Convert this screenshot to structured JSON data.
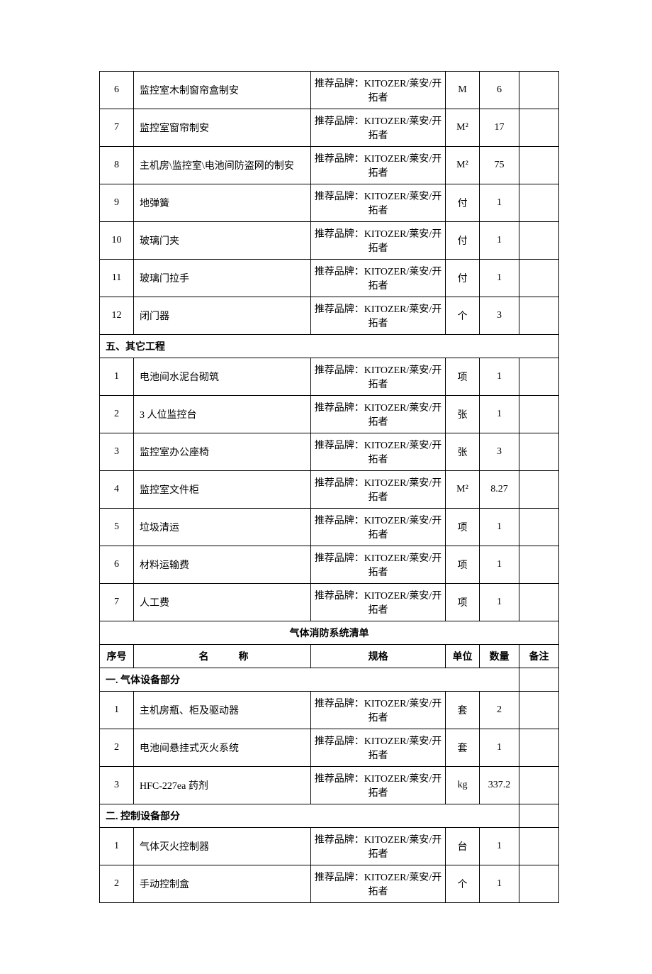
{
  "brand_spec": "推荐品牌：KITOZER/莱安/开拓者",
  "rows_top": [
    {
      "seq": "6",
      "name": "监控室木制窗帘盒制安",
      "unit": "M",
      "qty": "6"
    },
    {
      "seq": "7",
      "name": "监控室窗帘制安",
      "unit": "M²",
      "qty": "17"
    },
    {
      "seq": "8",
      "name": "主机房\\监控室\\电池间防盗网的制安",
      "unit": "M²",
      "qty": "75"
    },
    {
      "seq": "9",
      "name": "地弹簧",
      "unit": "付",
      "qty": "1"
    },
    {
      "seq": "10",
      "name": "玻璃门夹",
      "unit": "付",
      "qty": "1"
    },
    {
      "seq": "11",
      "name": "玻璃门拉手",
      "unit": "付",
      "qty": "1"
    },
    {
      "seq": "12",
      "name": "闭门器",
      "unit": "个",
      "qty": "3"
    }
  ],
  "section5_title": "五、其它工程",
  "rows_section5": [
    {
      "seq": "1",
      "name": "电池间水泥台砌筑",
      "unit": "项",
      "qty": "1"
    },
    {
      "seq": "2",
      "name": "3 人位监控台",
      "unit": "张",
      "qty": "1"
    },
    {
      "seq": "3",
      "name": "监控室办公座椅",
      "unit": "张",
      "qty": "3"
    },
    {
      "seq": "4",
      "name": "监控室文件柜",
      "unit": "M²",
      "qty": "8.27"
    },
    {
      "seq": "5",
      "name": "垃圾清运",
      "unit": "项",
      "qty": "1"
    },
    {
      "seq": "6",
      "name": "材料运输费",
      "unit": "项",
      "qty": "1"
    },
    {
      "seq": "7",
      "name": "人工费",
      "unit": "项",
      "qty": "1"
    }
  ],
  "gas_list_title": "气体消防系统清单",
  "headers": {
    "seq": "序号",
    "name": "名",
    "name2": "称",
    "spec": "规格",
    "unit": "单位",
    "qty": "数量",
    "note": "备注"
  },
  "gas_section1_title": "一. 气体设备部分",
  "rows_gas1": [
    {
      "seq": "1",
      "name": "主机房瓶、柜及驱动器",
      "unit": "套",
      "qty": "2"
    },
    {
      "seq": "2",
      "name": "电池间悬挂式灭火系统",
      "unit": "套",
      "qty": "1"
    },
    {
      "seq": "3",
      "name": "HFC-227ea 药剂",
      "unit": "kg",
      "qty": "337.2"
    }
  ],
  "gas_section2_title": "二. 控制设备部分",
  "rows_gas2": [
    {
      "seq": "1",
      "name": "气体灭火控制器",
      "unit": "台",
      "qty": "1"
    },
    {
      "seq": "2",
      "name": "手动控制盒",
      "unit": "个",
      "qty": "1"
    }
  ]
}
